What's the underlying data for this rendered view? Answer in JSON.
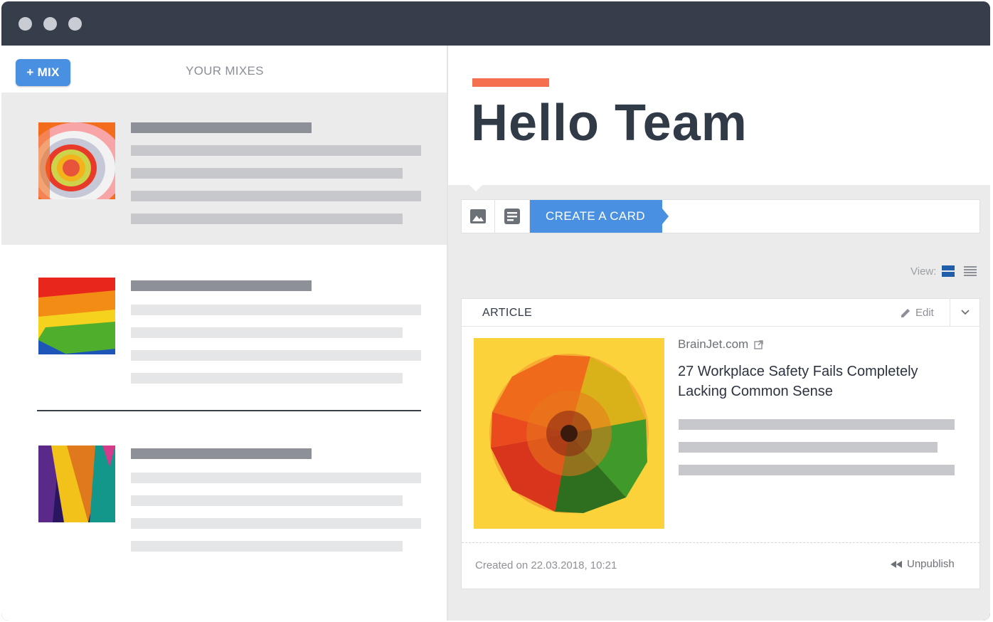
{
  "window": {
    "title_dots": [
      "close",
      "minimize",
      "maximize"
    ]
  },
  "sidebar": {
    "add_button_label": "+ MIX",
    "section_title": "YOUR MIXES",
    "items": [
      {
        "thumbnail": "concentric-rings-image",
        "selected": true
      },
      {
        "thumbnail": "parrot-feathers-image",
        "selected": false
      },
      {
        "thumbnail": "abstract-folds-image",
        "selected": false
      }
    ]
  },
  "main": {
    "greeting": "Hello Team",
    "toolbar": {
      "image_button_icon": "image-icon",
      "text_button_icon": "text-icon",
      "create_label": "CREATE A CARD"
    },
    "view": {
      "label": "View:",
      "options": [
        "grid-view-icon",
        "list-view-icon"
      ]
    },
    "card": {
      "type_label": "ARTICLE",
      "edit_label": "Edit",
      "source": "BrainJet.com",
      "headline": "27 Workplace Safety Fails Completely Lacking Common Sense",
      "created": "Created on 22.03.2018, 10:21",
      "unpublish_label": "Unpublish"
    }
  },
  "colors": {
    "titlebar": "#373e4b",
    "accent_blue": "#4a90e2",
    "accent_orange": "#f4704f",
    "heading": "#313a47"
  }
}
